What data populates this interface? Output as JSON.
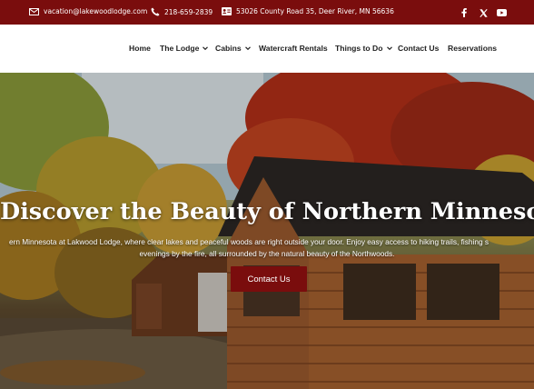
{
  "topbar": {
    "email": "vacation@lakewoodlodge.com",
    "phone": "218-659-2839",
    "address": "53026 County Road 35, Deer River, MN 56636",
    "icons": [
      "email-icon",
      "phone-icon",
      "address-card-icon"
    ],
    "social": [
      "facebook-icon",
      "x-icon",
      "youtube-icon"
    ],
    "color": "#7a0d0d"
  },
  "nav": {
    "items": [
      {
        "label": "Home"
      },
      {
        "label": "The Lodge"
      },
      {
        "label": "Cabins"
      },
      {
        "label": "Watercraft Rentals"
      },
      {
        "label": "Things to Do"
      },
      {
        "label": "Contact Us"
      },
      {
        "label": "Reservations"
      }
    ]
  },
  "hero": {
    "title": "Discover the Beauty of Northern Minnesota",
    "desc_line1": "ern Minnesota at Lakwood Lodge, where clear lakes and peaceful woods are right outside your door. Enjoy easy access to hiking trails, fishing s",
    "desc_line2": "evenings by the fire, all surrounded by the natural beauty of the Northwoods.",
    "cta": "Contact Us"
  }
}
